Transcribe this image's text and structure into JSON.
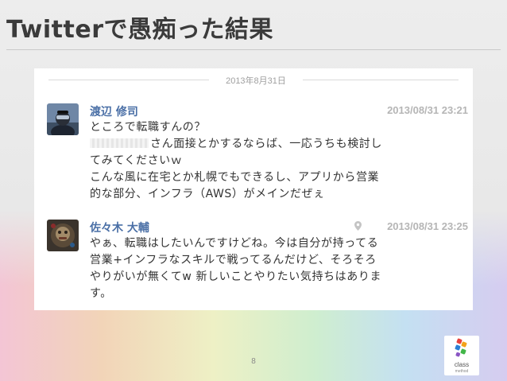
{
  "slide": {
    "title": "Twitterで愚痴った結果",
    "page_number": "8"
  },
  "timeline": {
    "date_separator": "2013年8月31日",
    "tweets": [
      {
        "user_name": "渡辺 修司",
        "timestamp": "2013/08/31 23:21",
        "lines": [
          "ところで転職すんの？",
          "さん面接とかするならば、一応うちも検討し",
          "てみてくださいｗ",
          "こんな風に在宅とか札幌でもできるし、アプリから営業",
          "的な部分、インフラ（AWS）がメインだぜぇ"
        ],
        "avatar_icon": "user-avatar-icon"
      },
      {
        "user_name": "佐々木 大輔",
        "timestamp": "2013/08/31 23:25",
        "lines": [
          "やぁ、転職はしたいんですけどね。今は自分が持ってる",
          "営業+インフラなスキルで戦ってるんだけど、そろそろ",
          "やりがいが無くてw 新しいことやりたい気持ちはありま",
          "す。"
        ],
        "avatar_icon": "user-avatar-icon",
        "location_icon": "location-pin-icon"
      }
    ]
  },
  "logo": {
    "name": "class",
    "sub": "method"
  },
  "colors": {
    "name_blue": "#4a6fa6",
    "timestamp_gray": "#b5b5b5",
    "title_dark": "#3b3b3b"
  }
}
